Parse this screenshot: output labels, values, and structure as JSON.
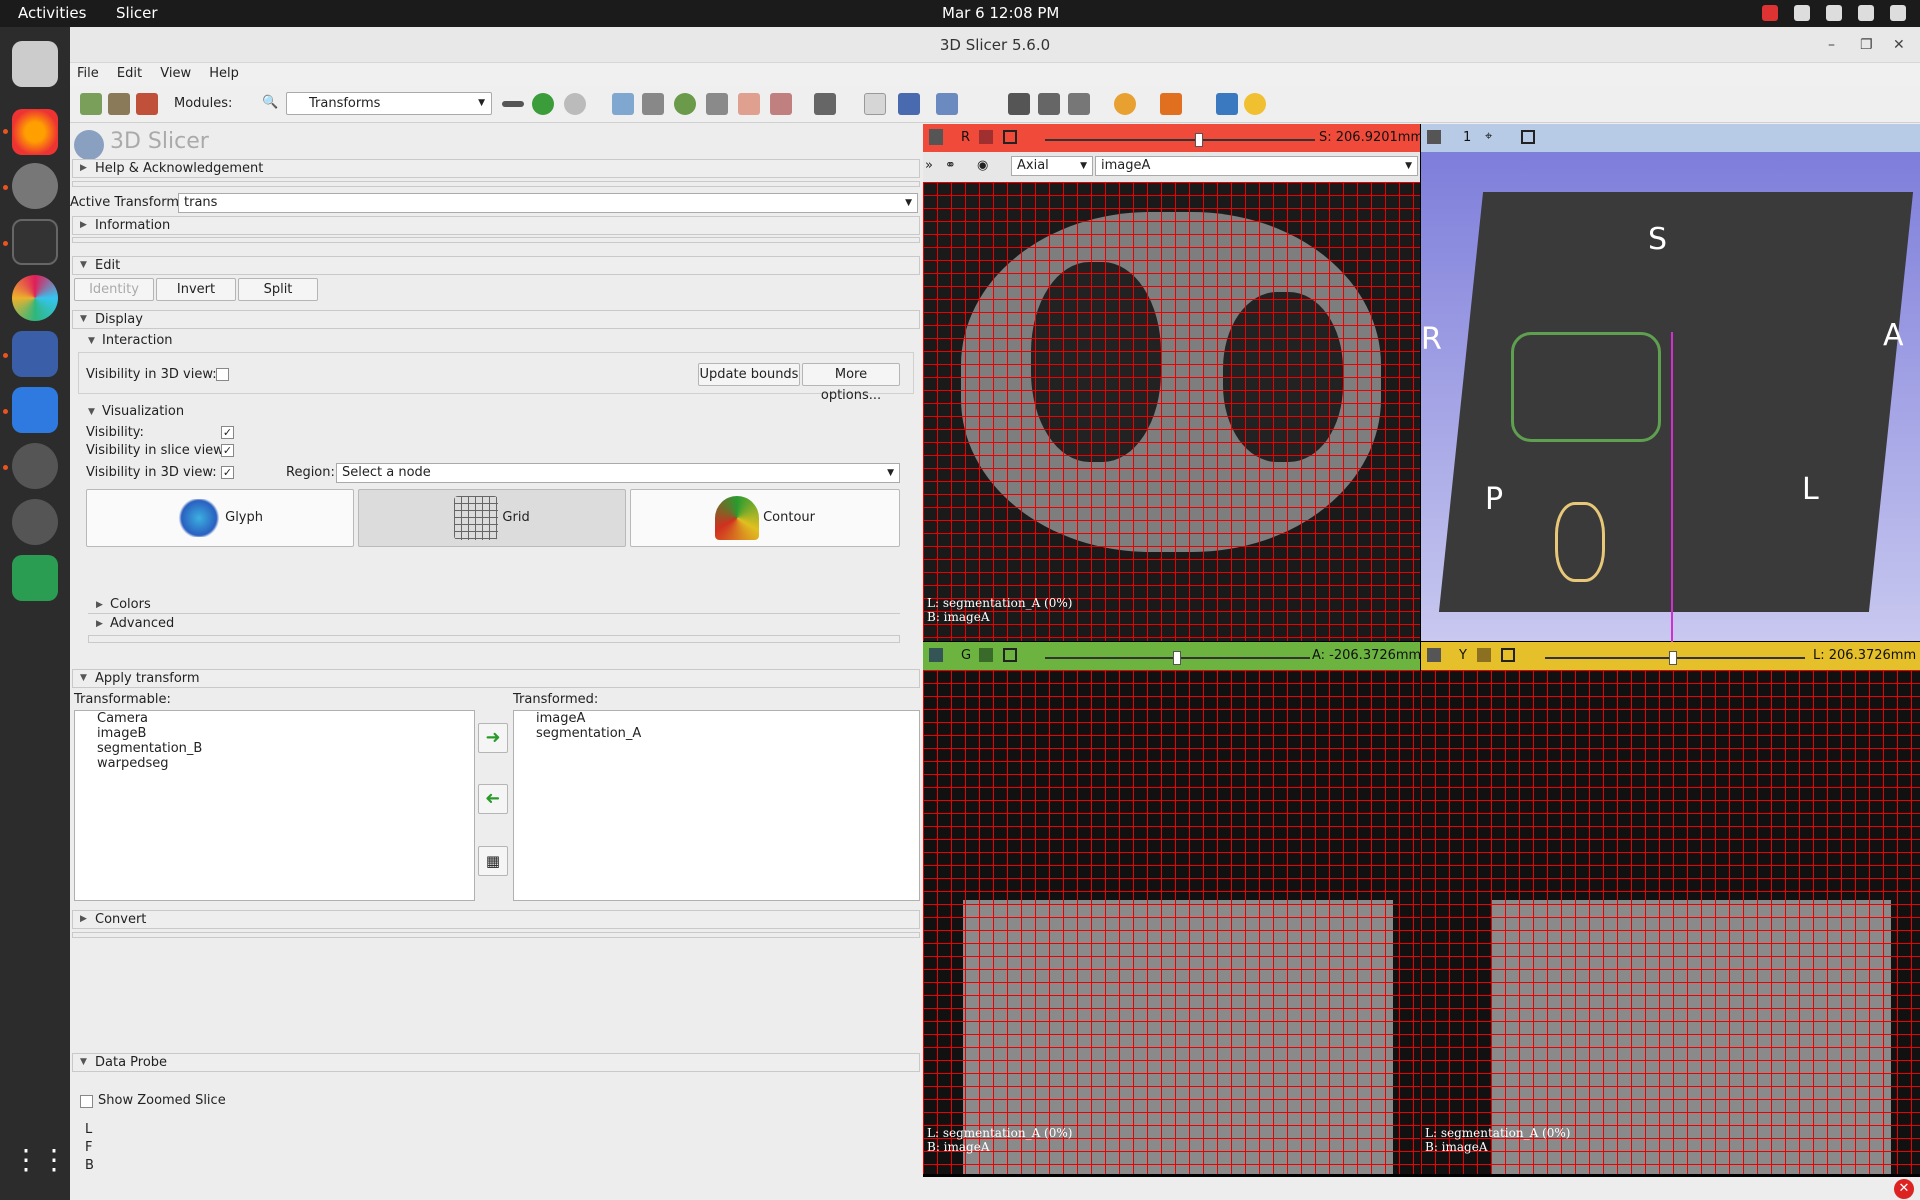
{
  "system": {
    "activities": "Activities",
    "app_name": "Slicer",
    "clock": "Mar 6  12:08 PM"
  },
  "window": {
    "title": "3D Slicer 5.6.0",
    "menu": [
      "File",
      "Edit",
      "View",
      "Help"
    ],
    "modules_label": "Modules:",
    "module_selected": "Transforms"
  },
  "panel": {
    "logo_text": "3D Slicer",
    "help_section": "Help & Acknowledgement",
    "active_transform_label": "Active Transform:",
    "active_transform_value": "trans",
    "information_section": "Information",
    "edit_section": "Edit",
    "identity_btn": "Identity",
    "invert_btn": "Invert",
    "split_btn": "Split",
    "display_section": "Display",
    "interaction_sub": "Interaction",
    "vis3d_label": "Visibility in 3D view:",
    "update_bounds_btn": "Update bounds",
    "more_options_btn": "More options...",
    "visualization_sub": "Visualization",
    "visibility_label": "Visibility:",
    "vis_slice_label": "Visibility in slice view:",
    "vis_3d_label2": "Visibility in 3D view:",
    "region_label": "Region:",
    "region_value": "Select a node",
    "glyph_btn": "Glyph",
    "grid_btn": "Grid",
    "contour_btn": "Contour",
    "colors_sub": "Colors",
    "advanced_sub": "Advanced",
    "apply_section": "Apply transform",
    "transformable_label": "Transformable:",
    "transformed_label": "Transformed:",
    "transformable_items": [
      "Camera",
      "imageB",
      "segmentation_B",
      "warpedseg"
    ],
    "transformed_items": [
      "imageA",
      "segmentation_A"
    ],
    "convert_section": "Convert",
    "data_probe_section": "Data Probe",
    "show_zoomed_label": "Show Zoomed Slice",
    "probe_lines": [
      "L",
      "F",
      "B"
    ]
  },
  "views": {
    "red": {
      "letter": "R",
      "offset": "S: 206.9201mm",
      "orientation": "Axial",
      "volume": "imageA",
      "overlay_l": "L: segmentation_A (0%)",
      "overlay_b": "B: imageA",
      "color": "#e8403a"
    },
    "threed": {
      "letter": "1",
      "labels": {
        "s": "S",
        "a": "A",
        "r": "R",
        "p": "P",
        "l": "L"
      }
    },
    "green": {
      "letter": "G",
      "offset": "A: -206.3726mm",
      "overlay_l": "L: segmentation_A (0%)",
      "overlay_b": "B: imageA",
      "color": "#6cb33f"
    },
    "yellow": {
      "letter": "Y",
      "offset": "L: 206.3726mm",
      "overlay_l": "L: segmentation_A (0%)",
      "overlay_b": "B: imageA",
      "color": "#e6c02a"
    }
  }
}
